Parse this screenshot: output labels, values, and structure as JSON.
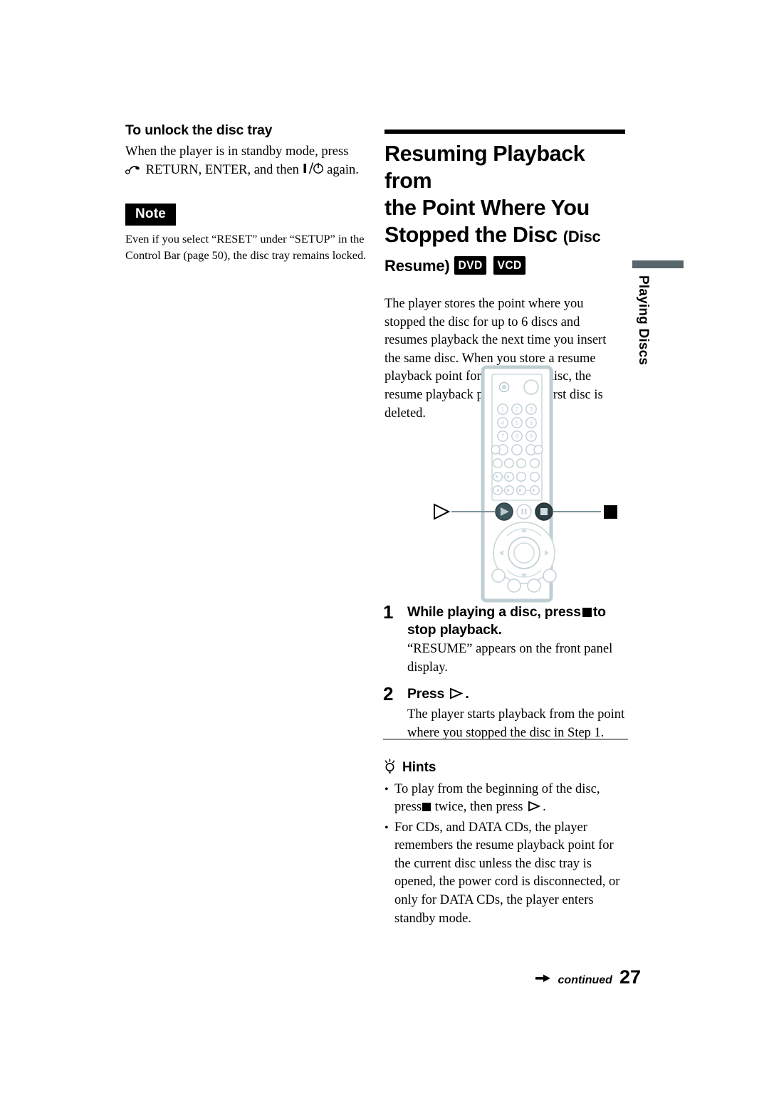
{
  "left_column": {
    "subheading": "To unlock the disc tray",
    "paragraph_before_icon": "When the player is in standby mode, press",
    "return_label": "RETURN, ENTER, and then",
    "power_suffix": "again.",
    "note_badge": "Note",
    "note_text": "Even if you select “RESET” under “SETUP” in the Control Bar (page 50), the disc tray remains locked.",
    "icons": {
      "return": "return-arrow-icon",
      "power": "power-standby-icon"
    }
  },
  "right_column": {
    "heading_line1": "Resuming Playback from",
    "heading_line2": "the Point Where You",
    "heading_line3": "Stopped the Disc",
    "heading_suffix_open": "(Disc",
    "heading_suffix_close": "Resume)",
    "badges": [
      "DVD",
      "VCD"
    ],
    "intro_paragraph": "The player stores the point where you stopped the disc for up to 6 discs and resumes playback the next time you insert the same disc. When you store a resume playback point for the seventh disc, the resume playback point for the first disc is deleted."
  },
  "side_tab": {
    "label": "Playing Discs",
    "bar_color": "#56666b"
  },
  "remote": {
    "figure_name": "remote-control-illustration",
    "callouts": {
      "left": "play-button-callout",
      "right": "stop-button-callout"
    },
    "highlighted_buttons": [
      "play",
      "stop"
    ],
    "keypad_digits": [
      "1",
      "2",
      "3",
      "4",
      "5",
      "6",
      "7",
      "8",
      "9",
      "0"
    ],
    "body_color": "#c3d0d4",
    "button_color": "#d8e2e5",
    "highlight_color": "#2e4349"
  },
  "steps": [
    {
      "number": "1",
      "title_before": "While playing a disc, press",
      "title_after": "to stop playback.",
      "glyph": "stop-square-icon",
      "description": "“RESUME” appears on the front panel display."
    },
    {
      "number": "2",
      "title_before": "Press",
      "title_after": ".",
      "glyph": "play-triangle-icon",
      "description": "The player starts playback from the point where you stopped the disc in Step 1."
    }
  ],
  "hints": {
    "icon": "lightbulb-icon",
    "title": "Hints",
    "items": [
      {
        "text_before": "To play from the beginning of the disc, press",
        "text_middle": "twice, then press",
        "text_after": ".",
        "glyph_1": "stop-square-icon",
        "glyph_2": "play-triangle-icon"
      },
      {
        "text": "For CDs, and DATA CDs, the player remembers the resume playback point for the current disc unless the disc tray is opened, the power cord is disconnected, or only for DATA CDs, the player enters standby mode."
      }
    ]
  },
  "footer": {
    "continued": "continued",
    "page_number": "27",
    "arrow_icon": "right-arrow-icon"
  }
}
